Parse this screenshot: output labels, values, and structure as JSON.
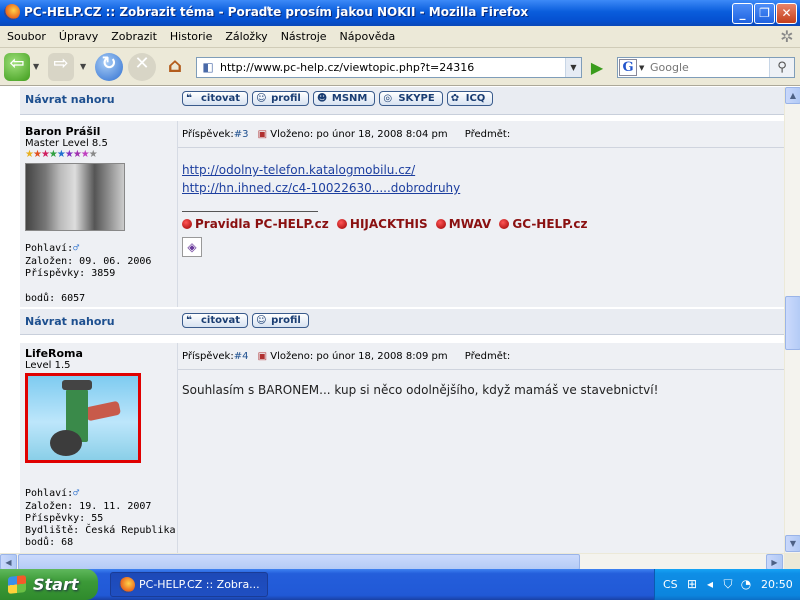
{
  "window": {
    "title": "PC-HELP.CZ :: Zobrazit téma - Poraďte prosím jakou NOKII - Mozilla Firefox",
    "controls": [
      "_",
      "❐",
      "✕"
    ]
  },
  "menu": [
    "Soubor",
    "Úpravy",
    "Zobrazit",
    "Historie",
    "Záložky",
    "Nástroje",
    "Nápověda"
  ],
  "toolbar": {
    "url": "http://www.pc-help.cz/viewtopic.php?t=24316",
    "search_placeholder": "Google",
    "search_engine_letter": "G"
  },
  "forum": {
    "back_to_top": "Návrat nahoru",
    "buttons_top": [
      "citovat",
      "profil",
      "MSNM",
      "SKYPE",
      "ICQ"
    ],
    "buttons_mid": [
      "citovat",
      "profil"
    ],
    "posts": [
      {
        "author": "Baron Prášil",
        "rank": "Master Level 8.5",
        "gender_label": "Pohlaví:",
        "joined": "Založen: 09. 06. 2006",
        "post_count": "Příspěvky: 3859",
        "points": "bodů: 6057",
        "post_label": "Příspěvek:",
        "post_num": "#3",
        "posted": "Vloženo: po únor 18, 2008 8:04 pm",
        "subject_label": "Předmět:",
        "links": [
          "http://odolny-telefon.katalogmobilu.cz/",
          "http://hn.ihned.cz/c4-10022630.....dobrodruhy"
        ],
        "signature": [
          "Pravidla PC-HELP.cz",
          "HIJACKTHIS",
          "MWAV",
          "GC-HELP.cz"
        ]
      },
      {
        "author": "LifeRoma",
        "rank": "Level 1.5",
        "gender_label": "Pohlaví:",
        "joined": "Založen: 19. 11. 2007",
        "post_count": "Příspěvky: 55",
        "residence": "Bydliště: Česká Republika",
        "points": "bodů: 68",
        "post_label": "Příspěvek:",
        "post_num": "#4",
        "posted": "Vloženo: po únor 18, 2008 8:09 pm",
        "subject_label": "Předmět:",
        "text": "Souhlasím s BARONEM... kup si něco odolnějšího, když mamáš ve stavebnictví!"
      }
    ]
  },
  "taskbar": {
    "start": "Start",
    "task": "PC-HELP.CZ :: Zobra...",
    "lang": "CS",
    "clock": "20:50"
  },
  "colors": {
    "link": "#1d4f8f",
    "signature": "#8a1010",
    "avatar_border": "#e00000"
  }
}
